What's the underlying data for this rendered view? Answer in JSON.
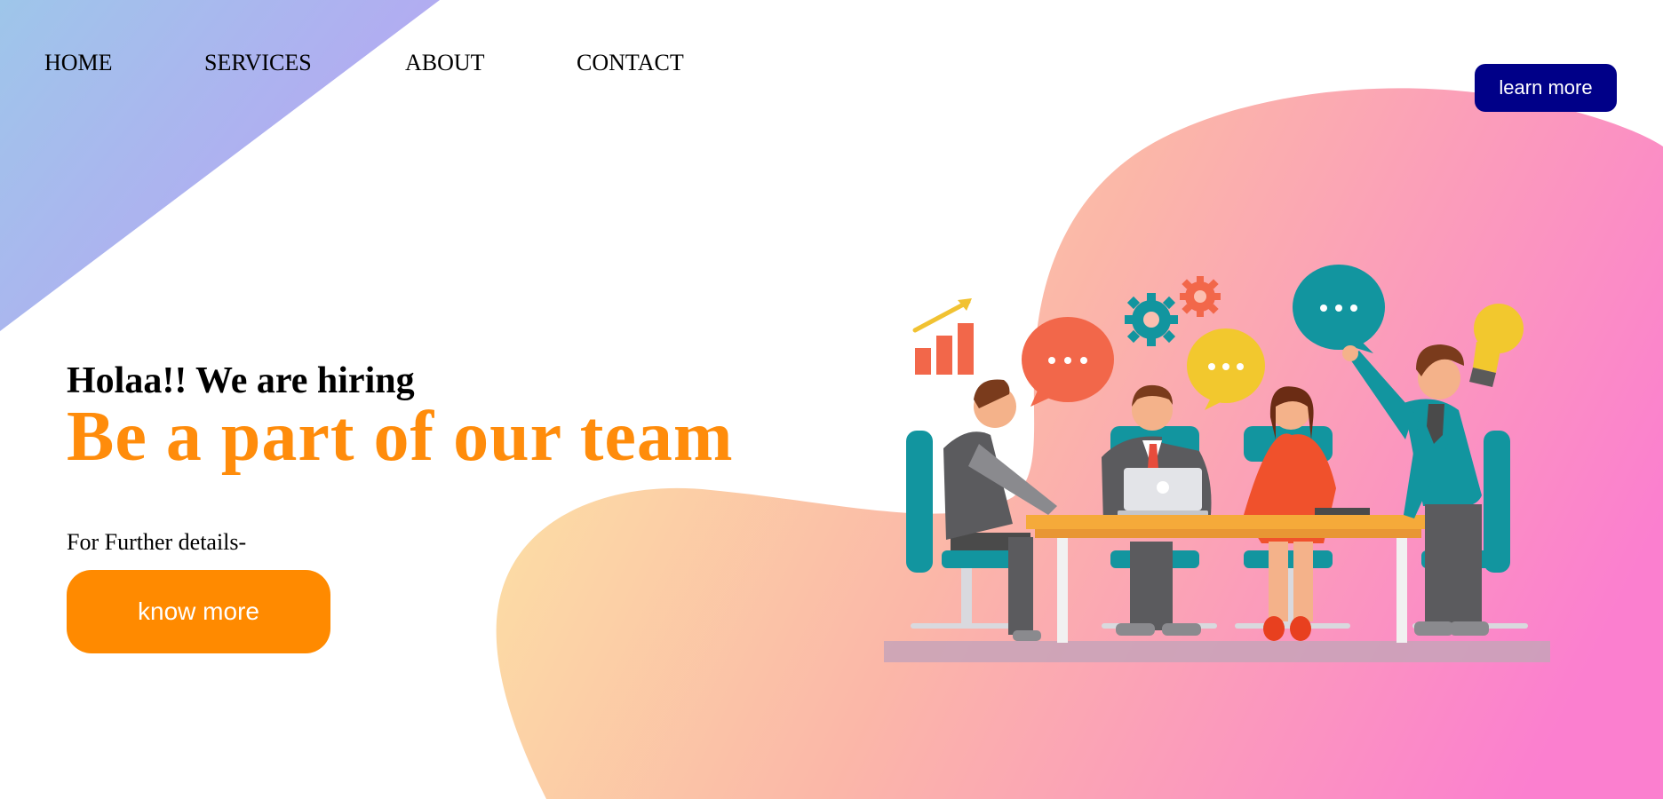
{
  "nav": {
    "home": "HOME",
    "services": "SERVICES",
    "about": "ABOUT",
    "contact": "CONTACT"
  },
  "header": {
    "learn_more_label": "learn more"
  },
  "hero": {
    "tagline": "Holaa!! We are hiring",
    "title": "Be a part of our team",
    "details": "For Further details-",
    "cta_label": "know more"
  },
  "colors": {
    "accent_orange": "#ff8a00",
    "button_navy": "#000088",
    "corner_gradient_start": "#9ec6ea",
    "corner_gradient_end": "#b9a3f4",
    "blob_gradient_start": "#fce6a4",
    "blob_gradient_end": "#fb7fcf"
  },
  "illustration": {
    "icons": [
      "bar-chart-icon",
      "speech-bubble-icon",
      "gear-icon",
      "lightbulb-icon",
      "laptop-icon"
    ]
  }
}
